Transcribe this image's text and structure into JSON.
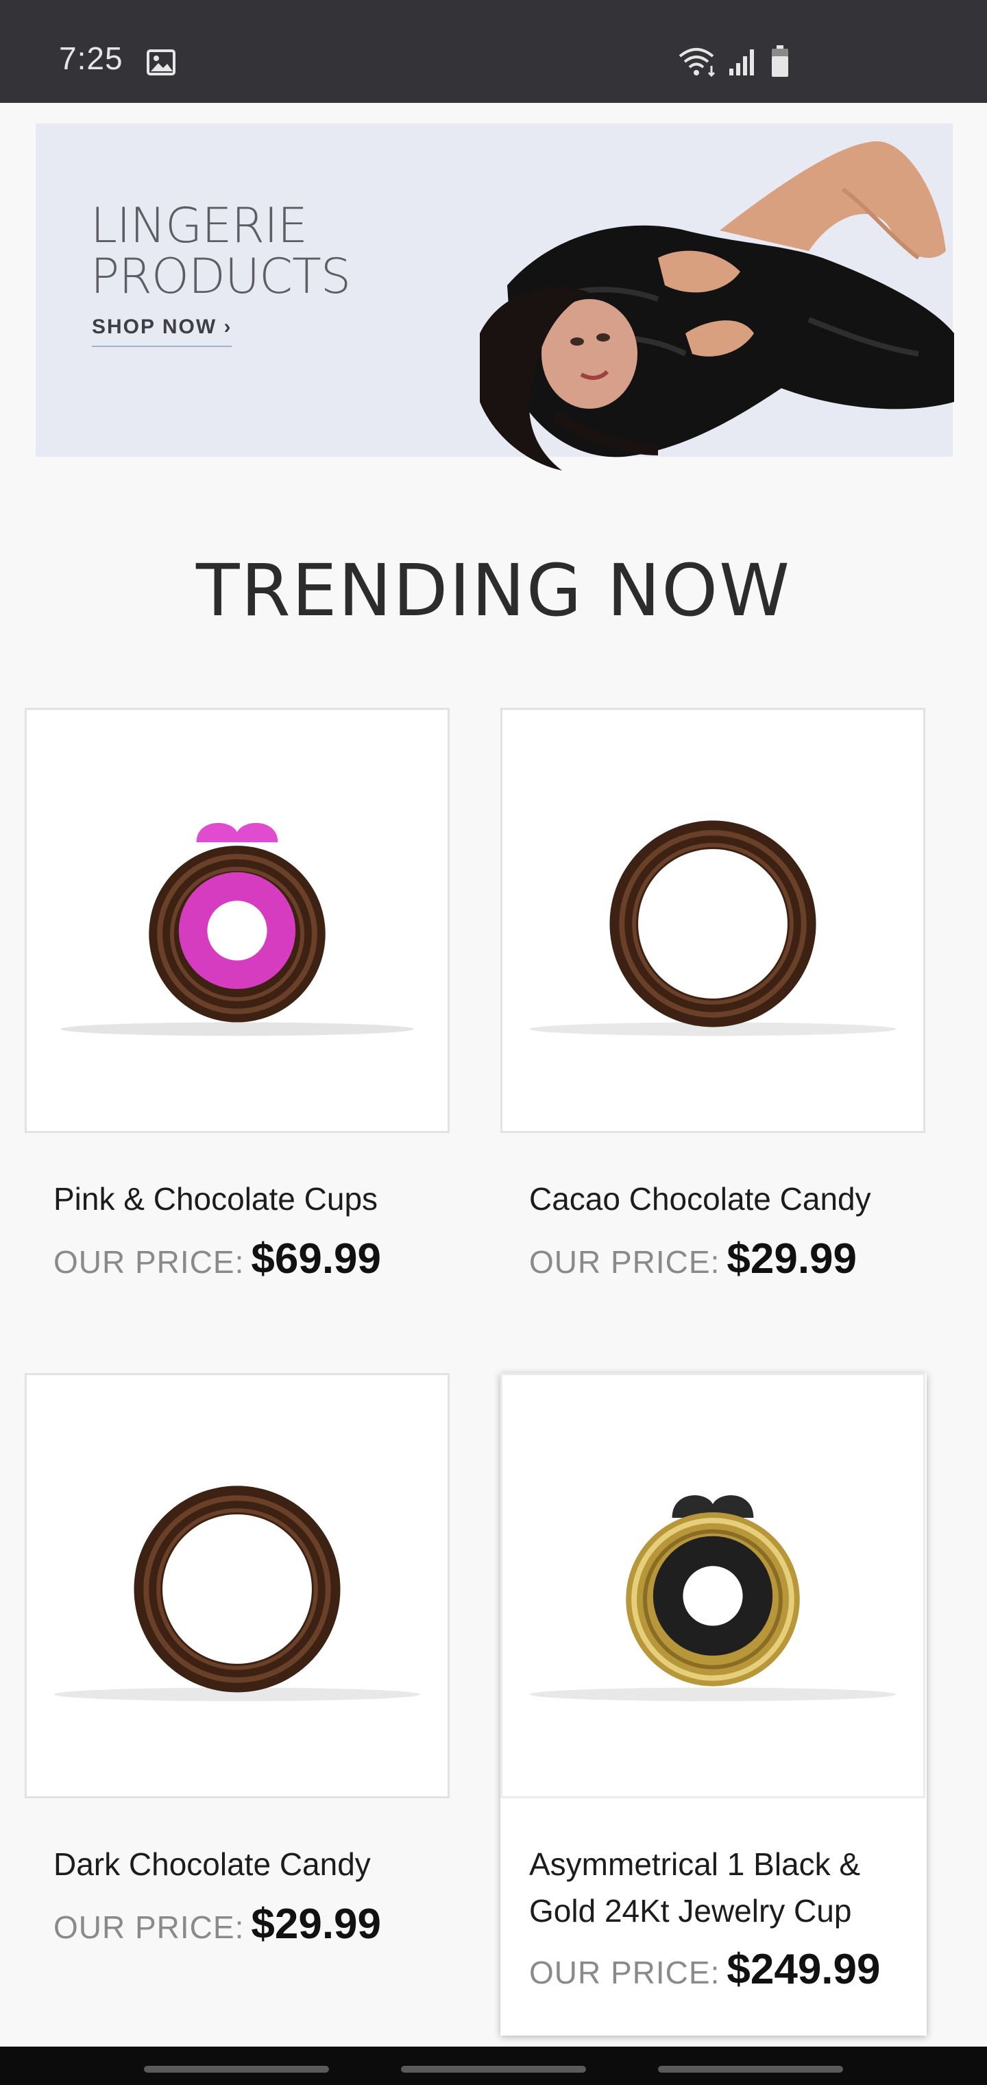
{
  "status_bar": {
    "time": "7:25",
    "icons": [
      "image-icon",
      "wifi-icon",
      "signal-icon",
      "battery-icon"
    ]
  },
  "banner": {
    "title": "LINGERIE\nPRODUCTS",
    "cta": "SHOP NOW ›",
    "background": "#e8eaf3"
  },
  "section": {
    "title": "TRENDING NOW"
  },
  "products": [
    {
      "name": "Pink & Chocolate Cups",
      "price_label": "OUR PRICE:",
      "price": "$69.99",
      "image": "pink-chocolate-cup-icon"
    },
    {
      "name": "Cacao Chocolate Candy",
      "price_label": "OUR PRICE:",
      "price": "$29.99",
      "image": "chocolate-ring-icon"
    },
    {
      "name": "Dark Chocolate Candy",
      "price_label": "OUR PRICE:",
      "price": "$29.99",
      "image": "chocolate-ring-icon"
    },
    {
      "name": "Asymmetrical 1 Black & Gold 24Kt Jewelry Cup",
      "price_label": "OUR PRICE:",
      "price": "$249.99",
      "image": "black-gold-cup-icon"
    }
  ],
  "colors": {
    "status_bar": "#333338",
    "chocolate": "#4a2a17",
    "pink": "#e040c8",
    "gold": "#c9a84a"
  }
}
